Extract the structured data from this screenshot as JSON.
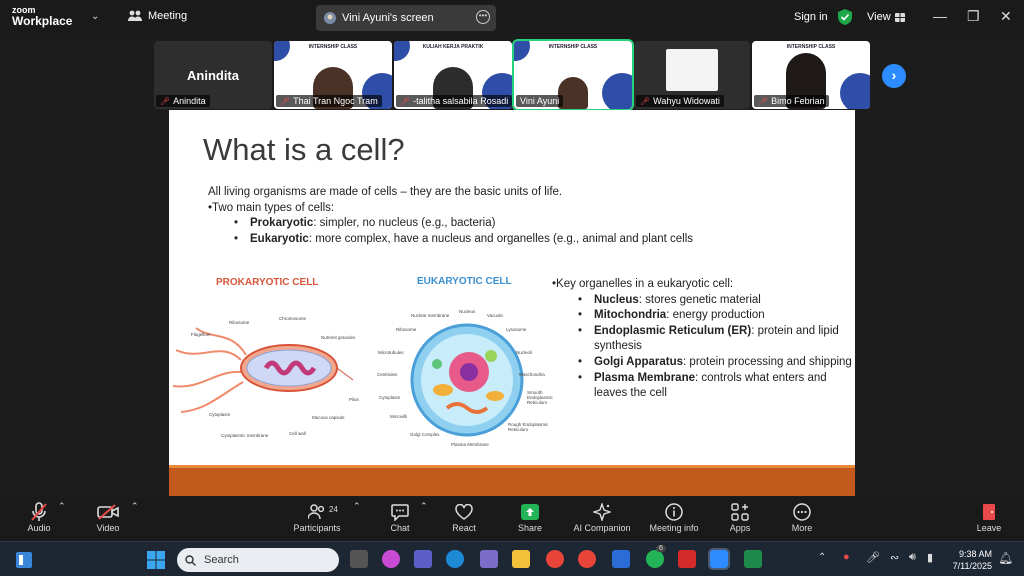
{
  "app": {
    "logo_line1": "zoom",
    "logo_line2": "Workplace",
    "meeting_label": "Meeting",
    "screen_tab": "Vini Ayuni's screen",
    "sign_in": "Sign in",
    "view_label": "View"
  },
  "participants": [
    {
      "name": "Anindita",
      "big_name": "Anindita",
      "muted": true,
      "kind": "avatar"
    },
    {
      "name": "Thai Tran Ngoc Tram",
      "muted": true,
      "kind": "video",
      "header": "INTERNSHIP CLASS"
    },
    {
      "name": "-talitha salsabila Rosadi",
      "muted": true,
      "kind": "video",
      "header": "KULIAH KERJA PRAKTIK"
    },
    {
      "name": "Vini Ayuni",
      "muted": false,
      "kind": "video",
      "header": "INTERNSHIP CLASS",
      "active": true
    },
    {
      "name": "Wahyu Widowati",
      "muted": true,
      "kind": "slide"
    },
    {
      "name": "Bimo Febrian",
      "muted": true,
      "kind": "video",
      "header": "INTERNSHIP CLASS"
    }
  ],
  "slide": {
    "title": "What is a cell?",
    "intro": "All living organisms are made of cells – they are the basic units of life.",
    "types_header": "•Two main types of cells:",
    "types": [
      {
        "term": "Prokaryotic",
        "desc": ": simpler, no nucleus (e.g., bacteria)"
      },
      {
        "term": "Eukaryotic",
        "desc": ": more complex, have a nucleus and organelles (e.g., animal and plant cells"
      }
    ],
    "prokaryotic_title": "PROKARYOTIC CELL",
    "eukaryotic_title": "EUKARYOTIC CELL",
    "prokaryotic_labels": [
      "Ribosome",
      "Chromosome",
      "Flagellum",
      "Nutrient granules",
      "Pilus",
      "Cytoplasm",
      "Mucous capsule",
      "Cytoplasmic membrane",
      "Cell wall"
    ],
    "eukaryotic_labels": [
      "Nuclear membrane",
      "Nucleus",
      "Vacuole",
      "Ribosome",
      "Lysosome",
      "Microtubules",
      "Nucleoli",
      "Centrioles",
      "Mitochondria",
      "Cytoplasm",
      "Smooth Endoplasmic Reticulum",
      "Microvilli",
      "Rough Endoplasmic Reticulum",
      "Golgi Complex",
      "Plasma Membrane"
    ],
    "organelles_header": "•Key organelles in a eukaryotic cell:",
    "organelles": [
      {
        "term": "Nucleus",
        "desc": ": stores genetic material"
      },
      {
        "term": "Mitochondria",
        "desc": ": energy production"
      },
      {
        "term": "Endoplasmic Reticulum (ER)",
        "desc": ": protein and lipid synthesis"
      },
      {
        "term": "Golgi Apparatus",
        "desc": ": protein processing and shipping"
      },
      {
        "term": "Plasma Membrane",
        "desc": ": controls what enters and leaves the cell"
      }
    ]
  },
  "toolbar": {
    "audio": "Audio",
    "video": "Video",
    "participants": "Participants",
    "participants_count": "24",
    "chat": "Chat",
    "react": "React",
    "share": "Share",
    "ai_companion": "AI Companion",
    "meeting_info": "Meeting info",
    "apps": "Apps",
    "more": "More",
    "leave": "Leave"
  },
  "taskbar": {
    "search_placeholder": "Search",
    "time": "9:38 AM",
    "date": "7/11/2025",
    "whatsapp_badge": "6"
  },
  "colors": {
    "accent_green": "#27d07a",
    "zoom_blue": "#2d8cff",
    "slide_footer": "#c25a1e",
    "prokaryotic_title": "#d8553a",
    "eukaryotic_title": "#3a8fd0"
  }
}
